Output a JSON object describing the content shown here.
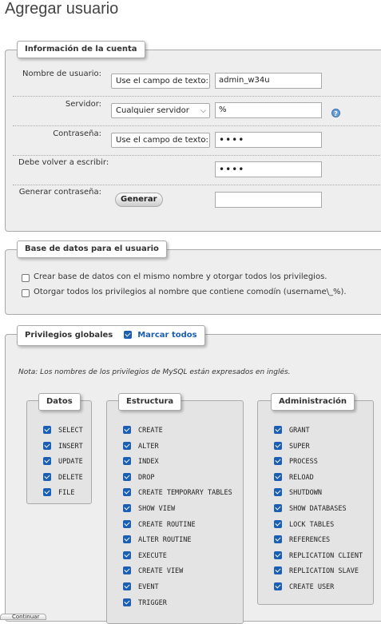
{
  "page": {
    "title": "Agregar usuario"
  },
  "account": {
    "legend": "Información de la cuenta",
    "username": {
      "label": "Nombre de usuario:",
      "select": "Use el campo de texto:",
      "value": "admin_w34u"
    },
    "host": {
      "label": "Servidor:",
      "select": "Cualquier servidor",
      "value": "%"
    },
    "password": {
      "label": "Contraseña:",
      "select": "Use el campo de texto:",
      "value": "••••"
    },
    "retype": {
      "label": "Debe volver a escribir:",
      "value": "••••"
    },
    "generate": {
      "label": "Generar contraseña:",
      "button": "Generar",
      "value": ""
    }
  },
  "database": {
    "legend": "Base de datos para el usuario",
    "options": [
      "Crear base de datos con el mismo nombre y otorgar todos los privilegios.",
      "Otorgar todos los privilegios al nombre que contiene comodín (username\\_%)."
    ]
  },
  "privileges": {
    "legend": "Privilegios globales",
    "check_all": "Marcar todos",
    "note": "Nota: Los nombres de los privilegios de MySQL están expresados en inglés.",
    "groups": {
      "data": {
        "title": "Datos",
        "items": [
          "SELECT",
          "INSERT",
          "UPDATE",
          "DELETE",
          "FILE"
        ]
      },
      "structure": {
        "title": "Estructura",
        "items": [
          "CREATE",
          "ALTER",
          "INDEX",
          "DROP",
          "CREATE TEMPORARY TABLES",
          "SHOW VIEW",
          "CREATE ROUTINE",
          "ALTER ROUTINE",
          "EXECUTE",
          "CREATE VIEW",
          "EVENT",
          "TRIGGER"
        ]
      },
      "admin": {
        "title": "Administración",
        "items": [
          "GRANT",
          "SUPER",
          "PROCESS",
          "RELOAD",
          "SHUTDOWN",
          "SHOW DATABASES",
          "LOCK TABLES",
          "REFERENCES",
          "REPLICATION CLIENT",
          "REPLICATION SLAVE",
          "CREATE USER"
        ]
      }
    }
  },
  "footer": {
    "tab": "Continuar"
  },
  "colors": {
    "accent": "#1a5fb4",
    "panel": "#eeeeee",
    "help": "#6a9fd8"
  },
  "icons": {
    "help": "help-icon"
  }
}
